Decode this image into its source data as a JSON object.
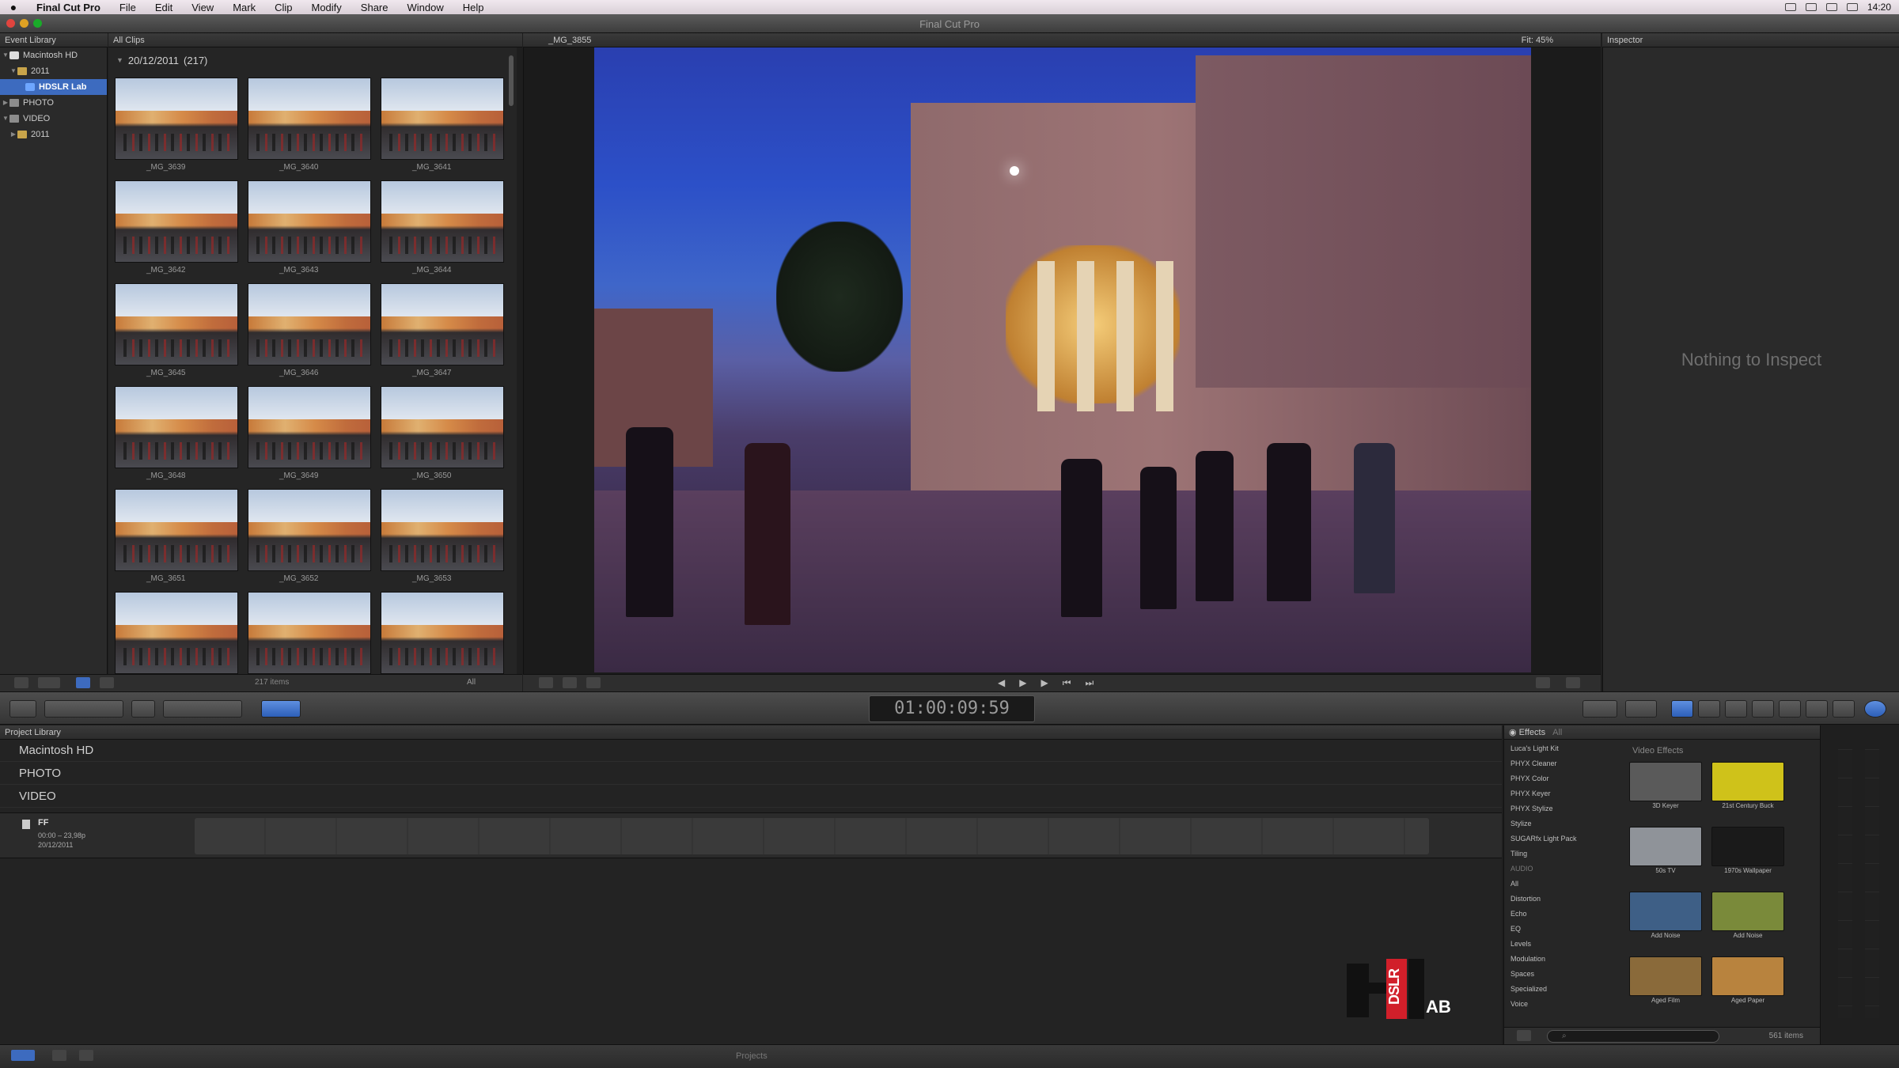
{
  "menubar": {
    "app": "Final Cut Pro",
    "items": [
      "File",
      "Edit",
      "View",
      "Mark",
      "Clip",
      "Modify",
      "Share",
      "Window",
      "Help"
    ],
    "clock": "14:20"
  },
  "window": {
    "title": "Final Cut Pro"
  },
  "event_library": {
    "header": "Event Library",
    "tree": [
      {
        "label": "Macintosh HD",
        "icon": "disk"
      },
      {
        "label": "2011",
        "icon": "folder"
      },
      {
        "label": "HDSLR Lab",
        "icon": "star",
        "selected": true
      },
      {
        "label": "PHOTO",
        "icon": "film"
      },
      {
        "label": "VIDEO",
        "icon": "film"
      },
      {
        "label": "2011",
        "icon": "folder"
      }
    ]
  },
  "browser": {
    "header": "All Clips",
    "date_group": "20/12/2011",
    "date_count": "(217)",
    "clips": [
      "_MG_3639",
      "_MG_3640",
      "_MG_3641",
      "_MG_3642",
      "_MG_3643",
      "_MG_3644",
      "_MG_3645",
      "_MG_3646",
      "_MG_3647",
      "_MG_3648",
      "_MG_3649",
      "_MG_3650",
      "_MG_3651",
      "_MG_3652",
      "_MG_3653",
      "",
      "",
      ""
    ],
    "items_count": "217 items",
    "filter": "All"
  },
  "viewer": {
    "clip_name": "_MG_3855",
    "zoom": "Fit: 45%"
  },
  "inspector": {
    "header": "Inspector",
    "empty_message": "Nothing to Inspect"
  },
  "toolbar": {
    "timecode": "01:00:09:59"
  },
  "project_library": {
    "header": "Project Library",
    "rows": [
      "Macintosh HD",
      "PHOTO",
      "VIDEO"
    ],
    "project": {
      "name": "FF",
      "duration": "00:00 – 23,98p",
      "date": "20/12/2011"
    }
  },
  "effects": {
    "header": "Effects",
    "filter": "All",
    "categories": [
      "Luca's Light Kit",
      "PHYX Cleaner",
      "PHYX Color",
      "PHYX Keyer",
      "PHYX Stylize",
      "Stylize",
      "SUGARfx Light Pack",
      "Tiling",
      "AUDIO",
      "All",
      "Distortion",
      "Echo",
      "EQ",
      "Levels",
      "Modulation",
      "Spaces",
      "Specialized",
      "Voice"
    ],
    "grid_title": "Video Effects",
    "tiles": [
      {
        "caption": "3D Keyer",
        "color": "#5a5a5a"
      },
      {
        "caption": "21st Century Buck",
        "color": "#cfc21a"
      },
      {
        "caption": "50s TV",
        "color": "#8f9399"
      },
      {
        "caption": "1970s Wallpaper",
        "color": "#1a1a1a"
      },
      {
        "caption": "Add Noise",
        "color": "#3e5f86"
      },
      {
        "caption": "Add Noise",
        "color": "#7a8a3a"
      },
      {
        "caption": "Aged Film",
        "color": "#8a6a3a"
      },
      {
        "caption": "Aged Paper",
        "color": "#b8833e"
      }
    ],
    "items_count": "561 items"
  },
  "bottom_bar": {
    "label": "Projects"
  },
  "logo": {
    "text_a": "DSLR",
    "text_b": "AB"
  }
}
